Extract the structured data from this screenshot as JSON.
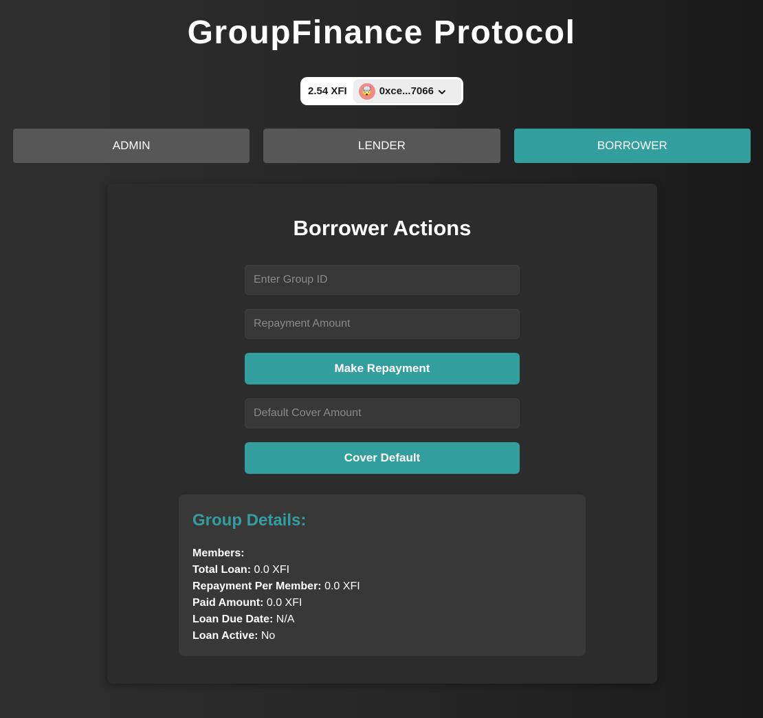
{
  "app": {
    "title": "GroupFinance Protocol"
  },
  "wallet": {
    "balance": "2.54 XFI",
    "avatar": "🤯",
    "address": "0xce...7066",
    "chevron_icon": "chevron-down-icon"
  },
  "tabs": [
    {
      "label": "ADMIN",
      "active": false
    },
    {
      "label": "LENDER",
      "active": false
    },
    {
      "label": "BORROWER",
      "active": true
    }
  ],
  "borrower": {
    "title": "Borrower Actions",
    "group_id_placeholder": "Enter Group ID",
    "group_id_value": "",
    "repayment_placeholder": "Repayment Amount",
    "repayment_value": "",
    "make_repayment_label": "Make Repayment",
    "default_cover_placeholder": "Default Cover Amount",
    "default_cover_value": "",
    "cover_default_label": "Cover Default"
  },
  "group_details": {
    "title": "Group Details:",
    "rows": [
      {
        "label": "Members:",
        "value": ""
      },
      {
        "label": "Total Loan:",
        "value": "0.0 XFI"
      },
      {
        "label": "Repayment Per Member:",
        "value": "0.0 XFI"
      },
      {
        "label": "Paid Amount:",
        "value": "0.0 XFI"
      },
      {
        "label": "Loan Due Date:",
        "value": "N/A"
      },
      {
        "label": "Loan Active:",
        "value": "No"
      }
    ]
  },
  "colors": {
    "accent": "#339e9e",
    "tab_inactive": "#575757",
    "panel": "#2c2c2c",
    "details_bg": "#383838"
  }
}
